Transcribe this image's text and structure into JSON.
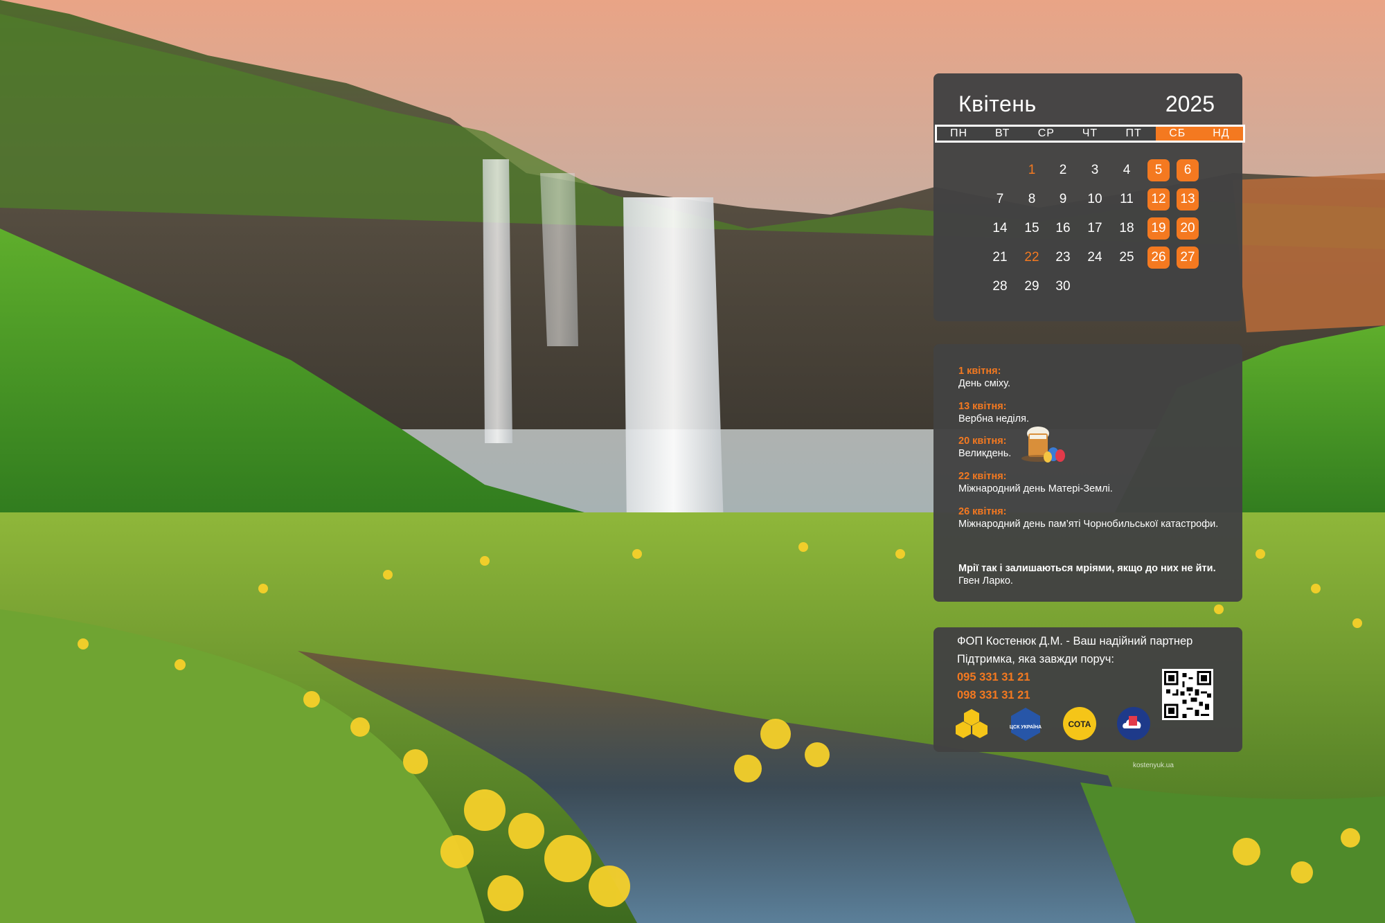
{
  "calendar": {
    "month": "Квітень",
    "year": "2025",
    "weekdays": [
      "ПН",
      "ВТ",
      "СР",
      "ЧТ",
      "ПТ",
      "СБ",
      "НД"
    ],
    "weeks": [
      [
        "",
        "1",
        "2",
        "3",
        "4",
        "5",
        "6"
      ],
      [
        "7",
        "8",
        "9",
        "10",
        "11",
        "12",
        "13"
      ],
      [
        "14",
        "15",
        "16",
        "17",
        "18",
        "19",
        "20"
      ],
      [
        "21",
        "22",
        "23",
        "24",
        "25",
        "26",
        "27"
      ],
      [
        "28",
        "29",
        "30",
        "",
        "",
        "",
        ""
      ]
    ],
    "holidays": [
      "1",
      "22"
    ],
    "accent_color": "#f47920"
  },
  "events": [
    {
      "date": "1 квітня:",
      "text": "День сміху."
    },
    {
      "date": "13 квітня:",
      "text": "Вербна неділя."
    },
    {
      "date": "20 квітня:",
      "text": "Великдень."
    },
    {
      "date": "22 квітня:",
      "text": "Міжнародний день Матері-Землі."
    },
    {
      "date": "26 квітня:",
      "text": "Міжнародний день пам’яті Чорнобильської катастрофи."
    }
  ],
  "quote": {
    "text": "Мрії так і залишаються мріями, якщо до них не йти.",
    "author": "Гвен Ларко."
  },
  "contact": {
    "line1": "ФОП Костенюк Д.М. - Ваш надійний партнер",
    "line2": "Підтримка, яка завжди поруч:",
    "phone1": "095 331 31 21",
    "phone2": "098 331 31 21",
    "logos": [
      {
        "icon": "honeycomb-logo",
        "label": ""
      },
      {
        "icon": "csk-ukraine-logo",
        "label": "ЦСК УКРАЇНА"
      },
      {
        "icon": "sota-logo",
        "label": "СОТА"
      },
      {
        "icon": "cloud-document-logo",
        "label": ""
      }
    ]
  },
  "watermark": "kostenyuk.ua"
}
